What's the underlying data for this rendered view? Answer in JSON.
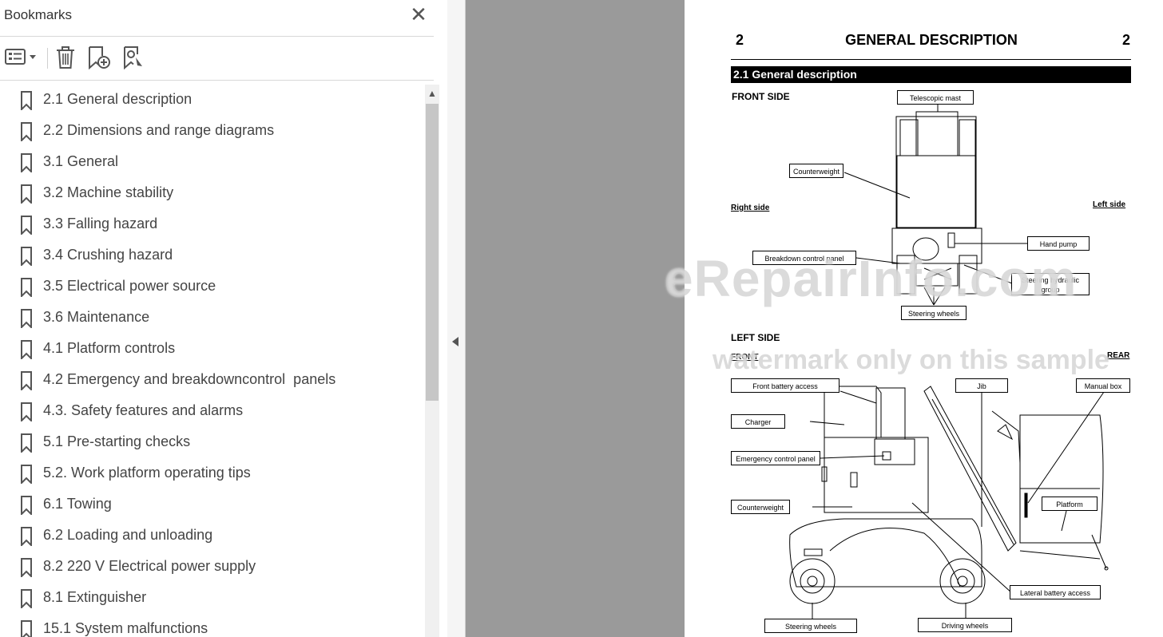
{
  "panel": {
    "title": "Bookmarks",
    "close_label": "✕",
    "toolbar": [
      {
        "name": "options-menu-button",
        "icon": "bookmark-options-icon"
      },
      {
        "name": "delete-bookmark-button",
        "icon": "trash-icon"
      },
      {
        "name": "new-bookmark-button",
        "icon": "bookmark-add-icon"
      },
      {
        "name": "find-bookmark-button",
        "icon": "bookmark-search-icon"
      }
    ],
    "bookmarks": [
      "2.1 General description",
      "2.2 Dimensions and range diagrams",
      "3.1 General",
      "3.2 Machine stability",
      "3.3 Falling hazard",
      "3.4 Crushing hazard",
      "3.5 Electrical power source",
      "3.6 Maintenance",
      "4.1 Platform controls",
      "4.2 Emergency and breakdowncontrol  panels",
      "4.3. Safety features and alarms",
      "5.1 Pre-starting checks",
      "5.2. Work platform operating tips",
      "6.1 Towing",
      "6.2 Loading and unloading",
      "8.2 220 V Electrical power supply",
      "8.1 Extinguisher",
      "15.1 System malfunctions"
    ]
  },
  "document": {
    "page_number_left": "2",
    "page_number_right": "2",
    "heading": "GENERAL DESCRIPTION",
    "section": "2.1 General description",
    "front": {
      "title": "FRONT SIDE",
      "right_side": "Right side",
      "left_side": "Left side",
      "labels": {
        "telescopic_mast": "Telescopic mast",
        "counterweight": "Counterweight",
        "hand_pump": "Hand pump",
        "breakdown_panel": "Breakdown control panel",
        "steering_hydraulic": "Steering hydraulic group",
        "steering_wheels": "Steering wheels"
      }
    },
    "left": {
      "title": "LEFT SIDE",
      "front": "FRONT",
      "rear": "REAR",
      "labels": {
        "front_battery": "Front battery access",
        "jib": "Jib",
        "manual_box": "Manual box",
        "charger": "Charger",
        "emergency_panel": "Emergency control panel",
        "counterweight": "Counterweight",
        "platform": "Platform",
        "lateral_battery": "Lateral battery access",
        "steering_wheels": "Steering wheels",
        "driving_wheels": "Driving wheels"
      }
    }
  },
  "watermark": {
    "brand": "eRepairInfo.com",
    "notice": "watermark only on this sample"
  }
}
